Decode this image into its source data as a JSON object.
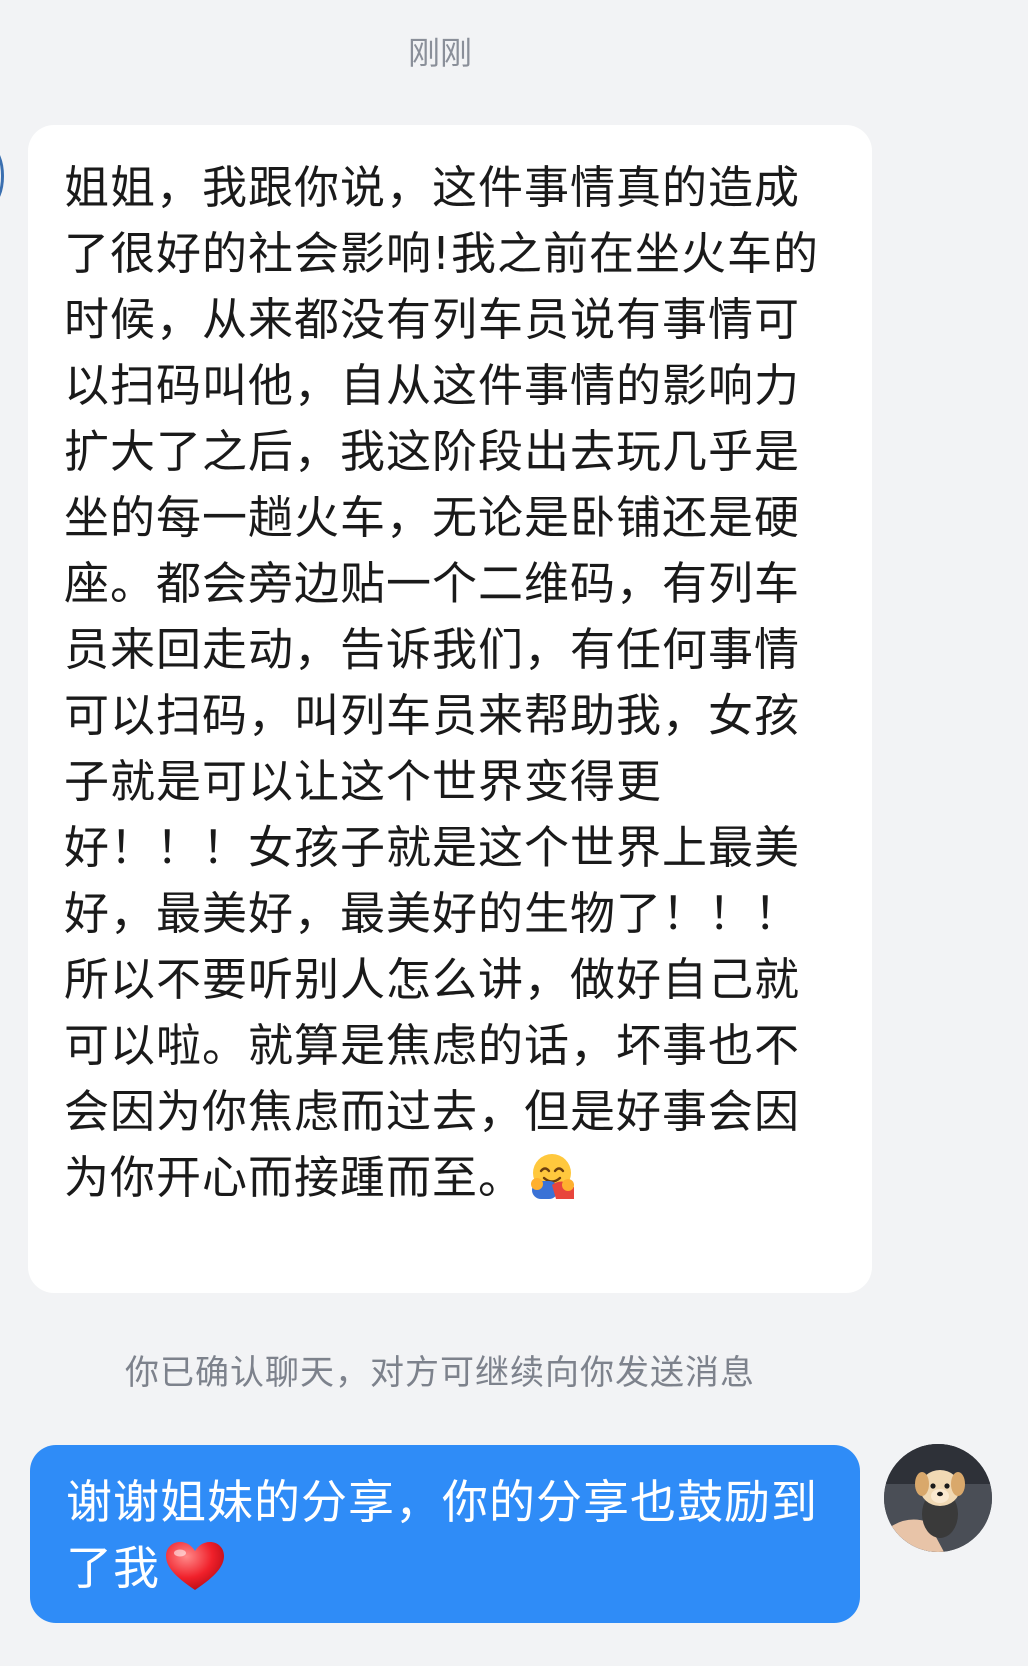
{
  "chat": {
    "timestamp": "刚刚",
    "incoming_message": "姐姐，我跟你说，这件事情真的造成了很好的社会影响!我之前在坐火车的时候，从来都没有列车员说有事情可以扫码叫他，自从这件事情的影响力扩大了之后，我这阶段出去玩几乎是坐的每一趟火车，无论是卧铺还是硬座。都会旁边贴一个二维码，有列车员来回走动，告诉我们，有任何事情可以扫码，叫列车员来帮助我，女孩子就是可以让这个世界变得更好！！！女孩子就是这个世界上最美好，最美好，最美好的生物了！！！所以不要听别人怎么讲，做好自己就可以啦。就算是焦虑的话，坏事也不会因为你焦虑而过去，但是好事会因为你开心而接踵而至。",
    "incoming_emoji": "hugging-face-emoji",
    "system_notice": "你已确认聊天，对方可继续向你发送消息",
    "outgoing_message": "谢谢姐妹的分享，你的分享也鼓励到了我",
    "outgoing_emoji": "red-heart-emoji",
    "colors": {
      "background": "#f2f3f5",
      "incoming_bubble": "#ffffff",
      "outgoing_bubble": "#2f8cf7",
      "meta_text": "#8a8f99"
    }
  }
}
